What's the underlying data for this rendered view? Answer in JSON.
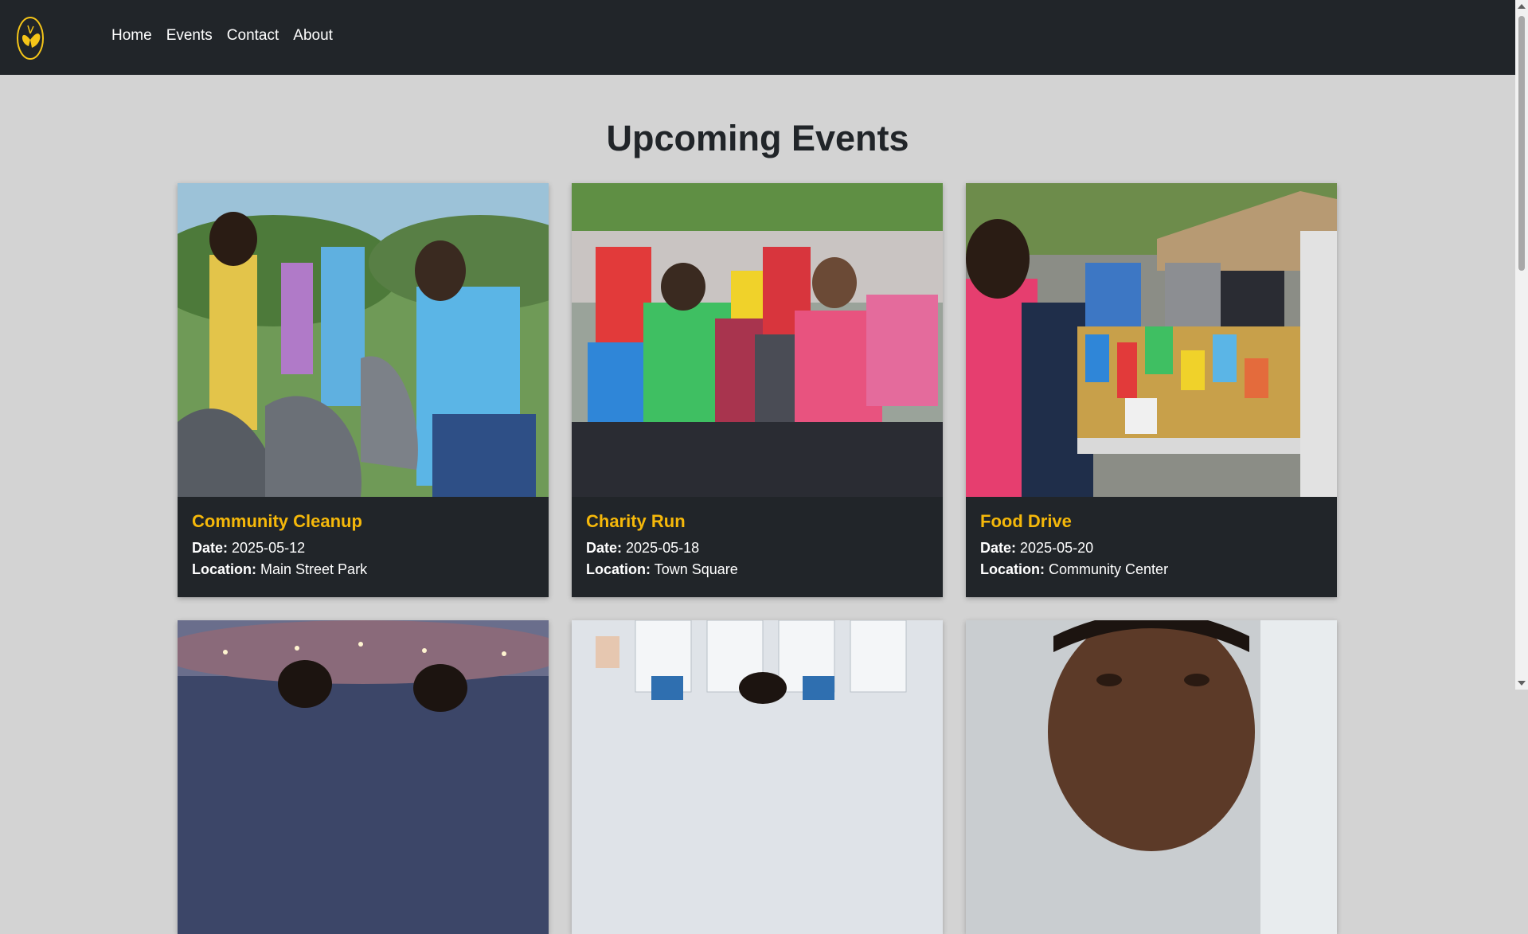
{
  "nav": {
    "logo_icon": "butterfly-logo-icon",
    "links": [
      {
        "label": "Home"
      },
      {
        "label": "Events"
      },
      {
        "label": "Contact"
      },
      {
        "label": "About"
      }
    ]
  },
  "main": {
    "title": "Upcoming Events",
    "date_label": "Date:",
    "location_label": "Location:",
    "events": [
      {
        "title": "Community Cleanup",
        "date": "2025-05-12",
        "location": "Main Street Park",
        "image": "volunteers-collecting-trash-photo"
      },
      {
        "title": "Charity Run",
        "date": "2025-05-18",
        "location": "Town Square",
        "image": "runners-group-photo"
      },
      {
        "title": "Food Drive",
        "date": "2025-05-20",
        "location": "Community Center",
        "image": "food-donation-table-photo"
      },
      {
        "image": "concert-stage-photo"
      },
      {
        "image": "office-meeting-photo"
      },
      {
        "image": "portrait-photo"
      }
    ]
  },
  "colors": {
    "navbar": "#212529",
    "page_bg": "#d3d3d3",
    "accent": "#f5b80a",
    "card_bg": "#212529"
  }
}
